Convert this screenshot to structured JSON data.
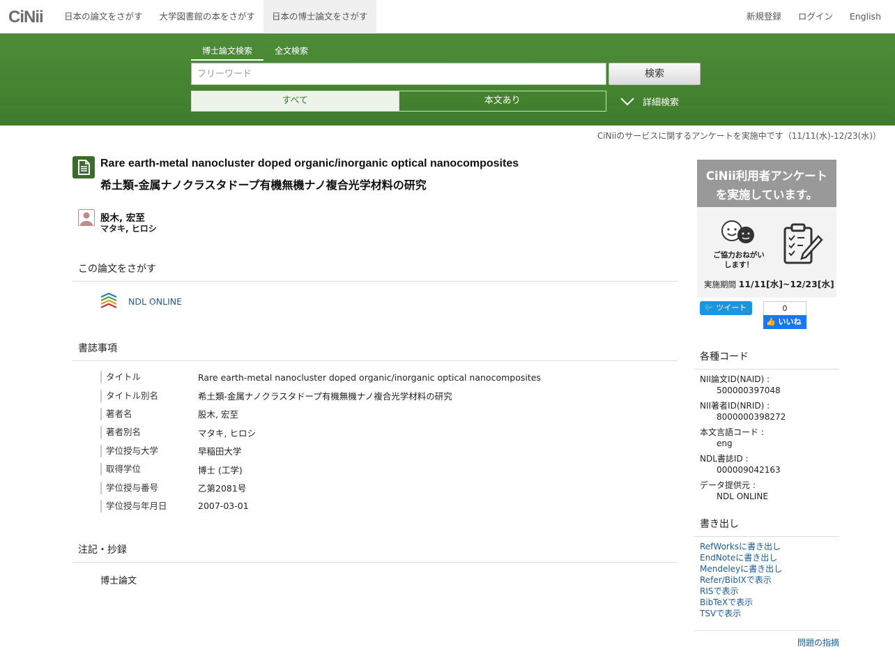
{
  "topnav": {
    "logo": "CiNii",
    "tabs": [
      {
        "label": "日本の論文をさがす"
      },
      {
        "label": "大学図書館の本をさがす"
      },
      {
        "label": "日本の博士論文をさがす"
      }
    ],
    "right": [
      {
        "label": "新規登録"
      },
      {
        "label": "ログイン"
      },
      {
        "label": "English"
      }
    ]
  },
  "search": {
    "tabs": [
      {
        "label": "博士論文検索"
      },
      {
        "label": "全文検索"
      }
    ],
    "placeholder": "フリーワード",
    "button": "検索",
    "filters": [
      {
        "label": "すべて"
      },
      {
        "label": "本文あり"
      }
    ],
    "advanced": "詳細検索"
  },
  "notice": "CiNiiのサービスに関するアンケートを実施中です（11/11(水)-12/23(水)）",
  "article": {
    "title_en": "Rare earth-metal nanocluster doped organic/inorganic optical nanocomposites",
    "title_ja": "希土類-金属ナノクラスタドープ有機無機ナノ複合光学材料の研究",
    "author": "股木, 宏至",
    "author_kana": "マタキ, ヒロシ"
  },
  "sections": {
    "search_this": "この論文をさがす",
    "bib": "書誌事項",
    "notes": "注記・抄録"
  },
  "ndl_link": "NDL ONLINE",
  "bib": [
    {
      "k": "タイトル",
      "v": "Rare earth-metal nanocluster doped organic/inorganic optical nanocomposites"
    },
    {
      "k": "タイトル別名",
      "v": "希土類-金属ナノクラスタドープ有機無機ナノ複合光学材料の研究"
    },
    {
      "k": "著者名",
      "v": "股木, 宏至"
    },
    {
      "k": "著者別名",
      "v": "マタキ, ヒロシ"
    },
    {
      "k": "学位授与大学",
      "v": "早稲田大学"
    },
    {
      "k": "取得学位",
      "v": "博士 (工学)"
    },
    {
      "k": "学位授与番号",
      "v": "乙第2081号"
    },
    {
      "k": "学位授与年月日",
      "v": "2007-03-01"
    }
  ],
  "notes_value": "博士論文",
  "banner": {
    "line1": "CiNii利用者アンケート",
    "line2": "を実施しています。",
    "msg1": "ご協力おねがい",
    "msg2": "します！",
    "period_label": "実施期間",
    "period": "11/11[水]~12/23[水]"
  },
  "social": {
    "tweet": "ツイート",
    "like_count": "0",
    "like": "いいね"
  },
  "side": {
    "codes_title": "各種コード",
    "codes": [
      {
        "k": "NII論文ID(NAID) :",
        "v": "500000397048"
      },
      {
        "k": "NII著者ID(NRID) :",
        "v": "8000000398272"
      },
      {
        "k": "本文言語コード :",
        "v": "eng"
      },
      {
        "k": "NDL書誌ID :",
        "v": "000009042163"
      },
      {
        "k": "データ提供元 :",
        "v": "NDL ONLINE"
      }
    ],
    "export_title": "書き出し",
    "exports": [
      {
        "label": "RefWorksに書き出し"
      },
      {
        "label": "EndNoteに書き出し"
      },
      {
        "label": "Mendeleyに書き出し"
      },
      {
        "label": "Refer/BibIXで表示"
      },
      {
        "label": "RISで表示"
      },
      {
        "label": "BibTeXで表示"
      },
      {
        "label": "TSVで表示"
      }
    ],
    "report": "問題の指摘"
  },
  "colors": {
    "brand_green": "#4a8736",
    "link": "#1a5c9e"
  }
}
